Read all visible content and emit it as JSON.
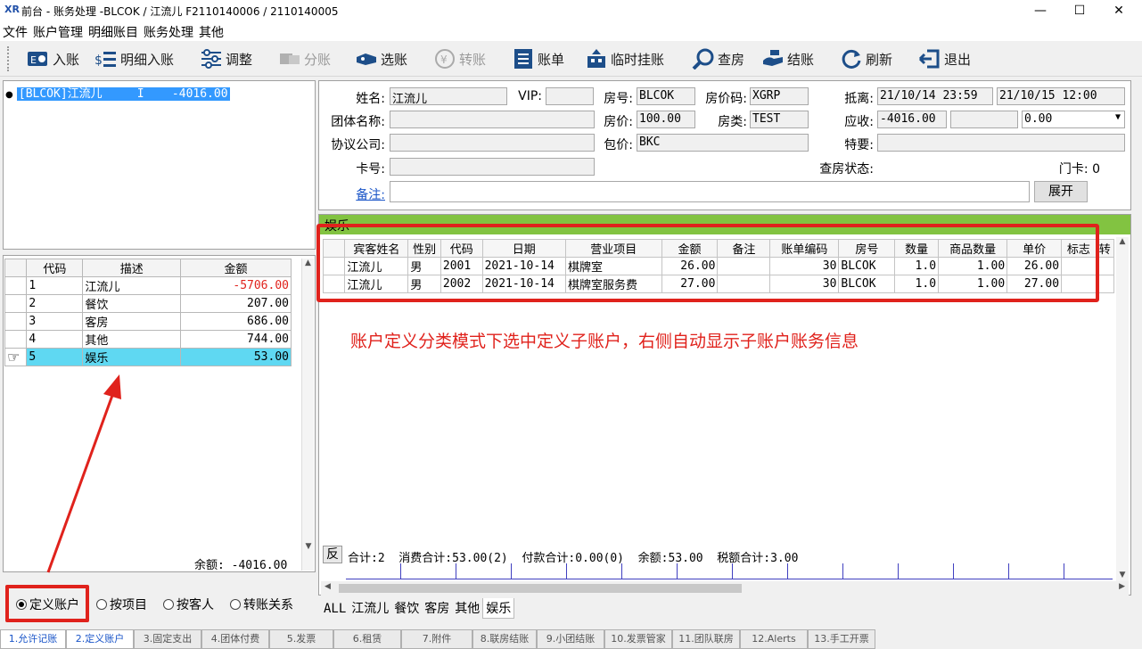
{
  "window": {
    "logo": "XR",
    "title": "前台 - 账务处理 -BLCOK / 江流儿 F2110140006 / 2110140005",
    "min": "—",
    "max": "☐",
    "close": "✕"
  },
  "menu": [
    "文件",
    "账户管理",
    "明细账目",
    "账务处理",
    "其他"
  ],
  "toolbar": [
    {
      "label": "入账",
      "icon": "post-icon",
      "enabled": true
    },
    {
      "label": "明细入账",
      "icon": "detail-post-icon",
      "enabled": true
    },
    {
      "label": "调整",
      "icon": "adjust-icon",
      "enabled": true
    },
    {
      "label": "分账",
      "icon": "split-icon",
      "enabled": false
    },
    {
      "label": "选账",
      "icon": "select-icon",
      "enabled": true
    },
    {
      "label": "转账",
      "icon": "transfer-icon",
      "enabled": false
    },
    {
      "label": "账单",
      "icon": "bill-icon",
      "enabled": true
    },
    {
      "label": "临时挂账",
      "icon": "temp-hold-icon",
      "enabled": true
    },
    {
      "label": "查房",
      "icon": "check-room-icon",
      "enabled": true
    },
    {
      "label": "结账",
      "icon": "checkout-icon",
      "enabled": true
    },
    {
      "label": "刷新",
      "icon": "refresh-icon",
      "enabled": true
    },
    {
      "label": "退出",
      "icon": "exit-icon",
      "enabled": true
    }
  ],
  "account_tree": {
    "bullet": "●",
    "item": "[BLCOK]江流儿     I    -4016.00"
  },
  "sub_accounts": {
    "headers": [
      "代码",
      "描述",
      "金额"
    ],
    "rows": [
      {
        "code": "1",
        "desc": "江流儿",
        "amount": "-5706.00"
      },
      {
        "code": "2",
        "desc": "餐饮",
        "amount": "207.00"
      },
      {
        "code": "3",
        "desc": "客房",
        "amount": "686.00"
      },
      {
        "code": "4",
        "desc": "其他",
        "amount": "744.00"
      },
      {
        "code": "5",
        "desc": "娱乐",
        "amount": "53.00"
      }
    ],
    "pointer": "☞",
    "balance": "余额: -4016.00"
  },
  "modes": [
    "定义账户",
    "按项目",
    "按客人",
    "转账关系"
  ],
  "guest": {
    "name_label": "姓名:",
    "name": "江流儿",
    "vip_label": "VIP:",
    "vip": "",
    "room_label": "房号:",
    "room": "BLCOK",
    "rate_code_label": "房价码:",
    "rate_code": "XGRP",
    "arr_dep_label": "抵离:",
    "arrival": "21/10/14 23:59",
    "departure": "21/10/15 12:00",
    "group_label": "团体名称:",
    "group": "",
    "price_label": "房价:",
    "price": "100.00",
    "room_type_label": "房类:",
    "room_type": "TEST",
    "receivable_label": "应收:",
    "receivable": "-4016.00",
    "receivable2": "",
    "receivable3": "0.00",
    "company_label": "协议公司:",
    "company": "",
    "package_label": "包价:",
    "package": "BKC",
    "special_label": "特要:",
    "special": "",
    "card_label": "卡号:",
    "card": "",
    "inspect_label": "查房状态:",
    "door_card_label": "门卡: 0",
    "remark_label": "备注:",
    "remark": "",
    "expand_button": "展开"
  },
  "detail": {
    "section_title": "娱乐",
    "headers": [
      "宾客姓名",
      "性别",
      "代码",
      "日期",
      "营业项目",
      "金额",
      "备注",
      "账单编码",
      "房号",
      "数量",
      "商品数量",
      "单价",
      "标志",
      "转"
    ],
    "rows": [
      [
        "江流儿",
        "男",
        "2001",
        "2021-10-14",
        "棋牌室",
        "26.00",
        "",
        "30",
        "BLCOK",
        "1.0",
        "1.00",
        "26.00",
        ""
      ],
      [
        "江流儿",
        "男",
        "2002",
        "2021-10-14",
        "棋牌室服务费",
        "27.00",
        "",
        "30",
        "BLCOK",
        "1.0",
        "1.00",
        "27.00",
        ""
      ]
    ],
    "annotation": "账户定义分类模式下选中定义子账户，右侧自动显示子账户账务信息",
    "footer_btn": "反",
    "summary": "合计:2  消费合计:53.00(2)  付款合计:0.00(0)  余额:53.00  税额合计:3.00"
  },
  "filter_tabs": [
    "ALL",
    "江流儿",
    "餐饮",
    "客房",
    "其他",
    "娱乐"
  ],
  "bottom_tabs": [
    "1.允许记账",
    "2.定义账户",
    "3.固定支出",
    "4.团体付费",
    "5.发票",
    "6.租赁",
    "7.附件",
    "8.联房结账",
    "9.小团结账",
    "10.发票管家",
    "11.团队联房",
    "12.Alerts",
    "13.手工开票"
  ],
  "colors": {
    "accent": "#e0221c",
    "selection": "#3399ff",
    "highlight_row": "#5fd8f2",
    "section_bar": "#82c341",
    "link": "#1a55c8"
  }
}
